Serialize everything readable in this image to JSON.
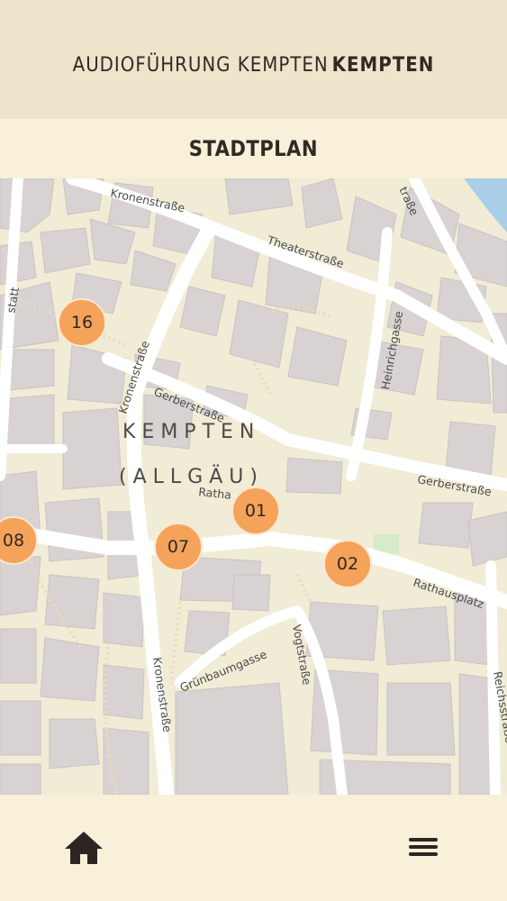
{
  "header": {
    "title_regular": "AUDIOFÜHRUNG KEMPTEN",
    "title_bold": "KEMPTEN"
  },
  "section": {
    "title": "STADTPLAN"
  },
  "map": {
    "place_name_line1": "KEMPTEN",
    "place_name_line2": "(ALLGÄU)",
    "streets": {
      "kronenstrasse_top": "Kronenstraße",
      "theaterstrasse": "Theaterstraße",
      "strasse_top_right": "traße",
      "heinrichgasse": "Heinrichgasse",
      "kronenstrasse_mid": "Kronenstraße",
      "gerberstrasse_left": "Gerberstraße",
      "gerberstrasse_right": "Gerberstraße",
      "rathausplatz_partial": "Ratha",
      "rathausplatz": "Rathausplatz",
      "gruenbaumgasse": "Grünbaumgasse",
      "vogtstrasse": "Vogtstraße",
      "kronenstrasse_bottom": "Kronenstraße",
      "reichsstrasse": "Reichsstraße",
      "left_edge": "statt"
    },
    "markers": [
      {
        "id": "16"
      },
      {
        "id": "01"
      },
      {
        "id": "07"
      },
      {
        "id": "02"
      },
      {
        "id": "08"
      }
    ]
  },
  "nav": {
    "home_icon": "home-icon",
    "menu_icon": "hamburger-menu-icon"
  },
  "colors": {
    "header_bg": "#ede4cb",
    "bar_bg": "#f8f0d8",
    "marker": "#f5a25a",
    "building": "#d9d4d3",
    "road": "#ffffff",
    "map_bg": "#f3eed8"
  }
}
